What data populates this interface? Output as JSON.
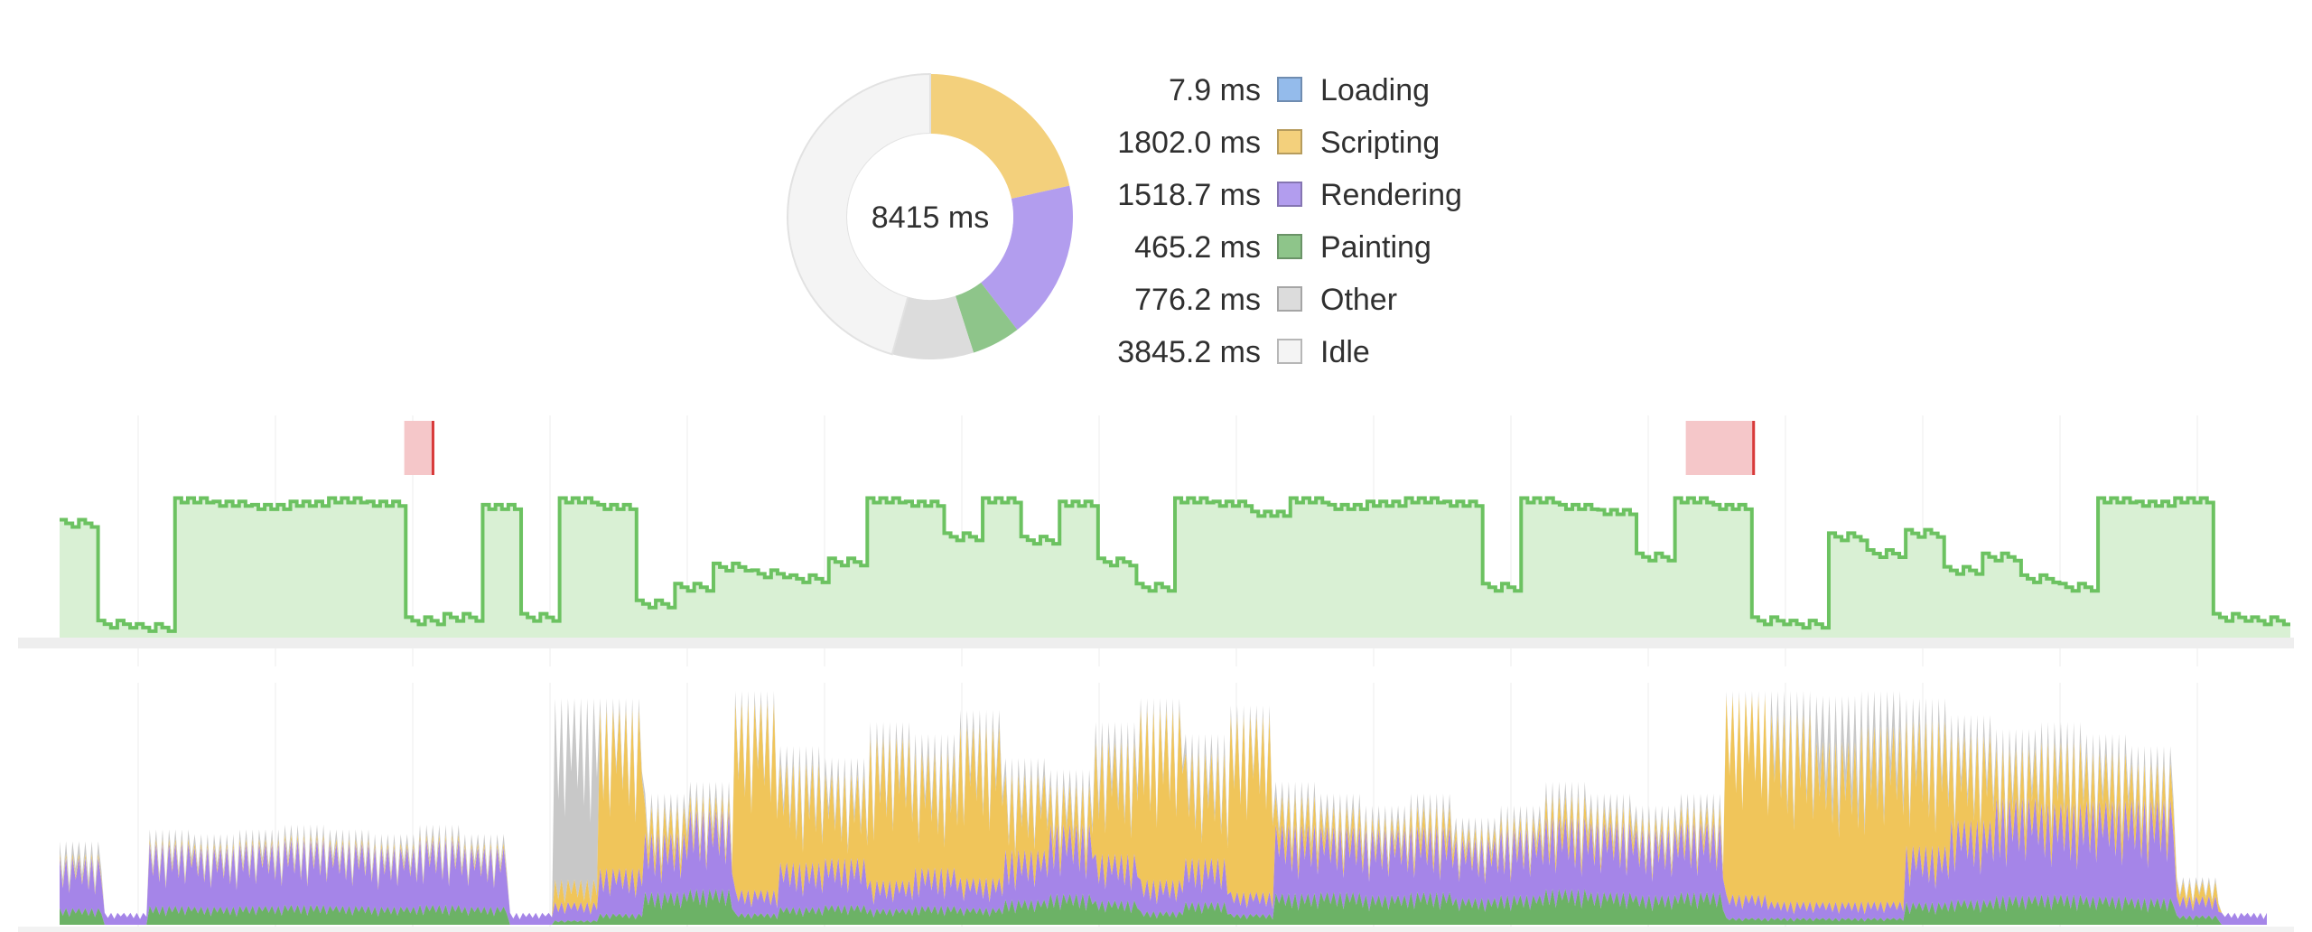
{
  "summary": {
    "total_label": "8415 ms",
    "categories": [
      {
        "key": "loading",
        "value_label": "7.9 ms",
        "label": "Loading",
        "ms": 7.9,
        "color": "#94bbeb"
      },
      {
        "key": "scripting",
        "value_label": "1802.0 ms",
        "label": "Scripting",
        "ms": 1802.0,
        "color": "#f3d07c"
      },
      {
        "key": "rendering",
        "value_label": "1518.7 ms",
        "label": "Rendering",
        "ms": 1518.7,
        "color": "#b29dee"
      },
      {
        "key": "painting",
        "value_label": "465.2 ms",
        "label": "Painting",
        "ms": 465.2,
        "color": "#8ec58a"
      },
      {
        "key": "other",
        "value_label": "776.2 ms",
        "label": "Other",
        "ms": 776.2,
        "color": "#dcdcdc"
      },
      {
        "key": "idle",
        "value_label": "3845.2 ms",
        "label": "Idle",
        "ms": 3845.2,
        "color": "#f4f4f4"
      }
    ]
  },
  "colors": {
    "fps_line": "#6cc261",
    "fps_fill": "#d9f0d4",
    "fps_baseline": "#eeeeee",
    "long_frame_fill": "#f5c7c9",
    "long_frame_edge": "#d83a3a",
    "gridline": "#ececec",
    "cpu_scripting": "#f0c55a",
    "cpu_rendering": "#a585e8",
    "cpu_painting": "#6cb266",
    "cpu_other": "#c8c8c8",
    "cpu_loading": "#86b0e6"
  },
  "chart_data": {
    "type": "area",
    "fps_levels": [
      0.68,
      0.08,
      0.06,
      0.82,
      0.8,
      0.78,
      0.8,
      0.82,
      0.8,
      0.1,
      0.12,
      0.78,
      0.12,
      0.82,
      0.78,
      0.2,
      0.3,
      0.42,
      0.38,
      0.35,
      0.45,
      0.82,
      0.8,
      0.6,
      0.82,
      0.58,
      0.8,
      0.45,
      0.3,
      0.82,
      0.8,
      0.74,
      0.82,
      0.78,
      0.8,
      0.82,
      0.8,
      0.3,
      0.82,
      0.78,
      0.75,
      0.48,
      0.82,
      0.78,
      0.1,
      0.08,
      0.6,
      0.5,
      0.62,
      0.4,
      0.48,
      0.35,
      0.3,
      0.82,
      0.8,
      0.82,
      0.12,
      0.1
    ],
    "long_frames": [
      {
        "start": 0.1545,
        "end": 0.168
      },
      {
        "start": 0.729,
        "end": 0.76
      }
    ],
    "cpu_intensity": [
      0.35,
      0.05,
      0.4,
      0.38,
      0.4,
      0.42,
      0.4,
      0.38,
      0.42,
      0.38,
      0.05,
      0.95,
      0.95,
      0.55,
      0.6,
      0.98,
      0.75,
      0.7,
      0.85,
      0.8,
      0.9,
      0.7,
      0.65,
      0.85,
      0.95,
      0.8,
      0.92,
      0.6,
      0.55,
      0.5,
      0.55,
      0.45,
      0.5,
      0.6,
      0.55,
      0.5,
      0.55,
      0.98,
      0.98,
      0.96,
      0.98,
      0.95,
      0.88,
      0.82,
      0.85,
      0.8,
      0.75,
      0.2,
      0.05
    ],
    "cpu_scripting_share": [
      0.05,
      0.0,
      0.05,
      0.05,
      0.05,
      0.05,
      0.05,
      0.05,
      0.05,
      0.05,
      0.0,
      0.1,
      0.7,
      0.2,
      0.1,
      0.8,
      0.55,
      0.5,
      0.7,
      0.6,
      0.7,
      0.45,
      0.25,
      0.55,
      0.75,
      0.55,
      0.8,
      0.2,
      0.15,
      0.1,
      0.15,
      0.1,
      0.1,
      0.15,
      0.12,
      0.1,
      0.12,
      0.85,
      0.8,
      0.7,
      0.75,
      0.55,
      0.4,
      0.25,
      0.3,
      0.25,
      0.2,
      0.3,
      0.0
    ],
    "cpu_other_share": [
      0.15,
      0.0,
      0.1,
      0.1,
      0.1,
      0.1,
      0.1,
      0.1,
      0.1,
      0.1,
      0.0,
      0.8,
      0.05,
      0.1,
      0.1,
      0.05,
      0.1,
      0.1,
      0.08,
      0.1,
      0.08,
      0.1,
      0.1,
      0.1,
      0.05,
      0.1,
      0.05,
      0.1,
      0.1,
      0.1,
      0.1,
      0.1,
      0.1,
      0.1,
      0.1,
      0.1,
      0.1,
      0.02,
      0.1,
      0.2,
      0.15,
      0.1,
      0.1,
      0.1,
      0.1,
      0.1,
      0.1,
      0.1,
      0.0
    ],
    "cpu_painting_share": [
      0.2,
      0.0,
      0.2,
      0.2,
      0.2,
      0.2,
      0.2,
      0.2,
      0.2,
      0.2,
      0.0,
      0.02,
      0.05,
      0.25,
      0.25,
      0.05,
      0.1,
      0.12,
      0.08,
      0.1,
      0.08,
      0.15,
      0.2,
      0.12,
      0.06,
      0.12,
      0.05,
      0.22,
      0.25,
      0.25,
      0.25,
      0.25,
      0.25,
      0.25,
      0.25,
      0.25,
      0.25,
      0.03,
      0.03,
      0.03,
      0.03,
      0.1,
      0.12,
      0.15,
      0.15,
      0.15,
      0.15,
      0.2,
      0.0
    ]
  }
}
